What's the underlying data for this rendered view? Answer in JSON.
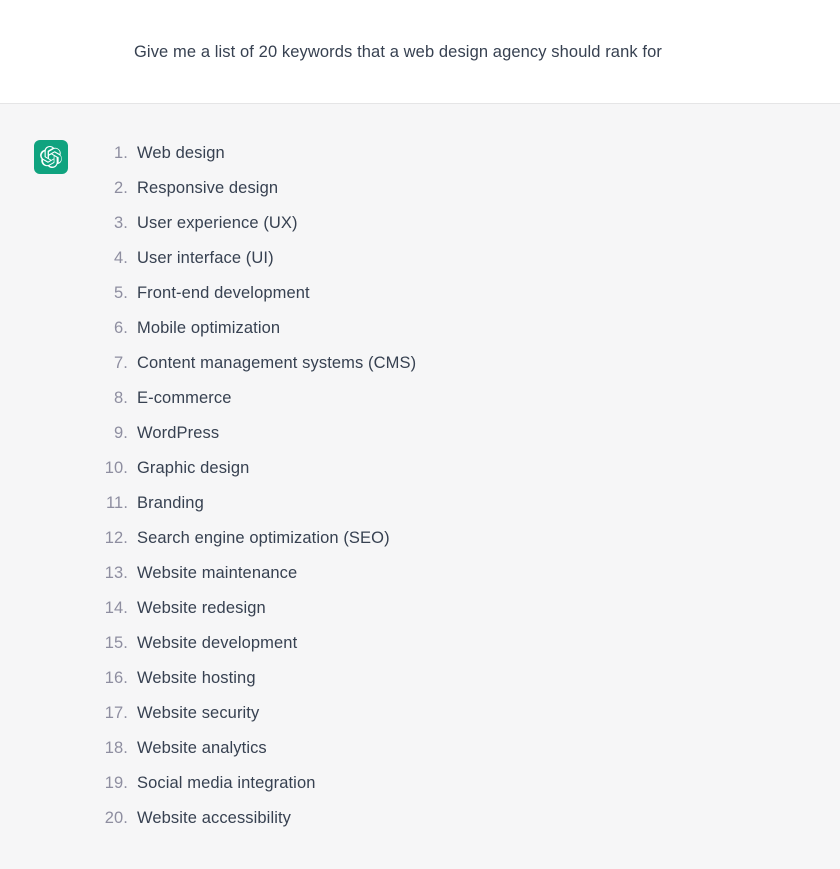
{
  "theme": {
    "prompt_background": "#ffffff",
    "answer_background": "#f6f6f7",
    "divider_color": "#e5e5e6",
    "text_color": "#374151",
    "number_color": "#8e8ea0",
    "brand_green": "#10a37f"
  },
  "prompt": {
    "text": "Give me a list of 20 keywords that a web design agency should rank for"
  },
  "answer": {
    "avatar_icon": "openai-logo-icon",
    "items": [
      {
        "number": "1.",
        "label": "Web design"
      },
      {
        "number": "2.",
        "label": "Responsive design"
      },
      {
        "number": "3.",
        "label": "User experience (UX)"
      },
      {
        "number": "4.",
        "label": "User interface (UI)"
      },
      {
        "number": "5.",
        "label": "Front-end development"
      },
      {
        "number": "6.",
        "label": "Mobile optimization"
      },
      {
        "number": "7.",
        "label": "Content management systems (CMS)"
      },
      {
        "number": "8.",
        "label": "E-commerce"
      },
      {
        "number": "9.",
        "label": "WordPress"
      },
      {
        "number": "10.",
        "label": "Graphic design"
      },
      {
        "number": "11.",
        "label": "Branding"
      },
      {
        "number": "12.",
        "label": "Search engine optimization (SEO)"
      },
      {
        "number": "13.",
        "label": "Website maintenance"
      },
      {
        "number": "14.",
        "label": "Website redesign"
      },
      {
        "number": "15.",
        "label": "Website development"
      },
      {
        "number": "16.",
        "label": "Website hosting"
      },
      {
        "number": "17.",
        "label": "Website security"
      },
      {
        "number": "18.",
        "label": "Website analytics"
      },
      {
        "number": "19.",
        "label": "Social media integration"
      },
      {
        "number": "20.",
        "label": "Website accessibility"
      }
    ]
  }
}
